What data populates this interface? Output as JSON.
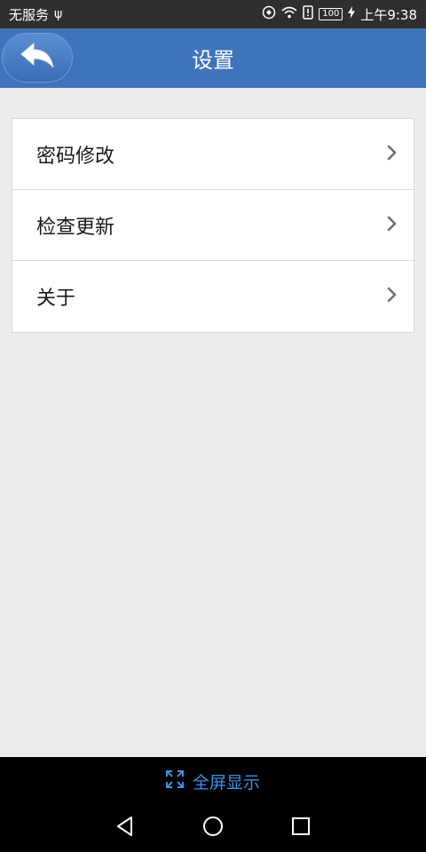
{
  "status_bar": {
    "carrier": "无服务",
    "usb_glyph": "ψ",
    "battery": "100",
    "time": "上午9:38"
  },
  "header": {
    "title": "设置",
    "back_icon": "back-arrow-icon"
  },
  "settings": {
    "items": [
      {
        "label": "密码修改"
      },
      {
        "label": "检查更新"
      },
      {
        "label": "关于"
      }
    ]
  },
  "bottom": {
    "fullscreen_label": "全屏显示"
  },
  "colors": {
    "header_bg": "#3f73bb",
    "accent": "#3d8ee6",
    "page_bg": "#ececec"
  }
}
